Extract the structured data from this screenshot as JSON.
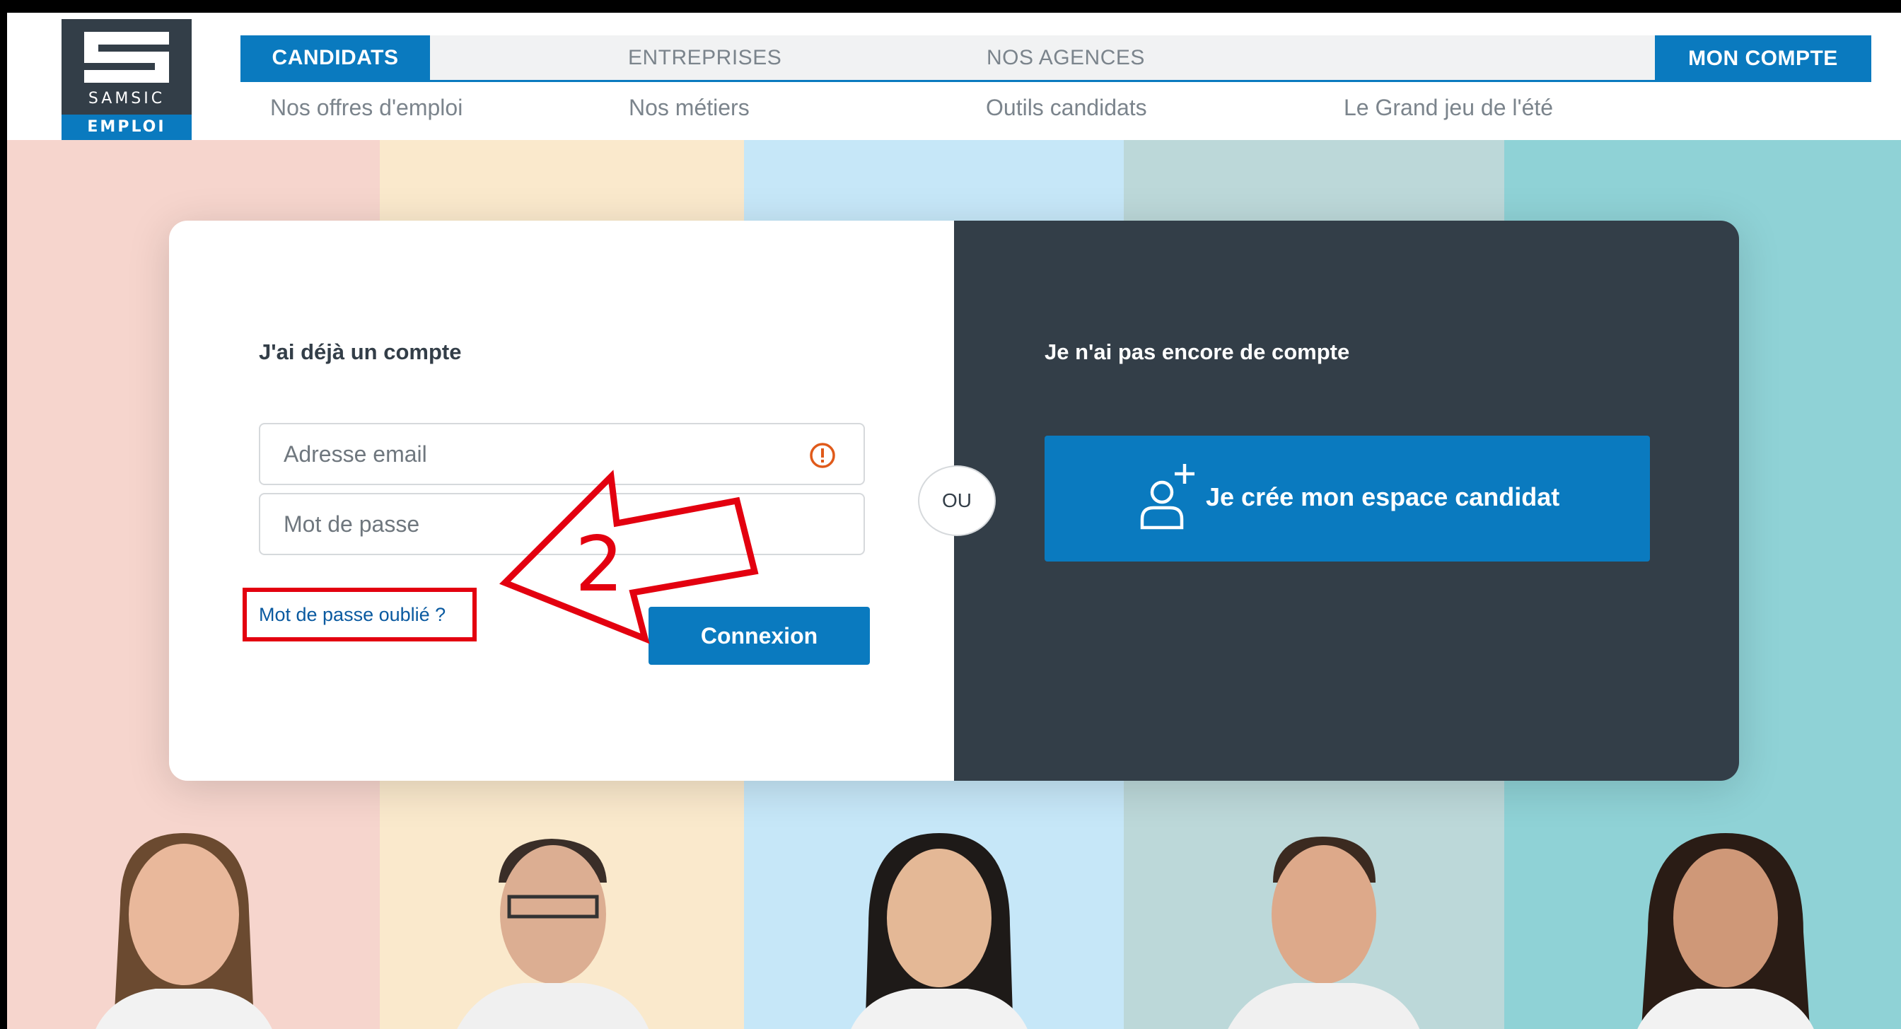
{
  "brand": {
    "logo_word": "SAMSIC",
    "logo_sub": "EMPLOI",
    "accent_color": "#0a7abf",
    "dark_color": "#333e48",
    "annotation_color": "#e3000f"
  },
  "topnav": {
    "candidats": "CANDIDATS",
    "entreprises": "ENTREPRISES",
    "agences": "NOS AGENCES",
    "compte": "MON COMPTE"
  },
  "subnav": {
    "offres": "Nos offres d'emploi",
    "metiers": "Nos métiers",
    "outils": "Outils candidats",
    "jeu": "Le Grand jeu de l'été"
  },
  "login": {
    "title": "J'ai déjà un compte",
    "email_placeholder": "Adresse email",
    "password_placeholder": "Mot de passe",
    "forgot_label": "Mot de passe oublié ?",
    "submit_label": "Connexion",
    "email_alert_icon": "alert-circle-icon"
  },
  "separator": {
    "label": "OU"
  },
  "signup": {
    "title": "Je n'ai pas encore de compte",
    "button_label": "Je crée mon espace candidat",
    "button_icon": "user-plus-icon"
  },
  "annotation": {
    "number": "2"
  }
}
